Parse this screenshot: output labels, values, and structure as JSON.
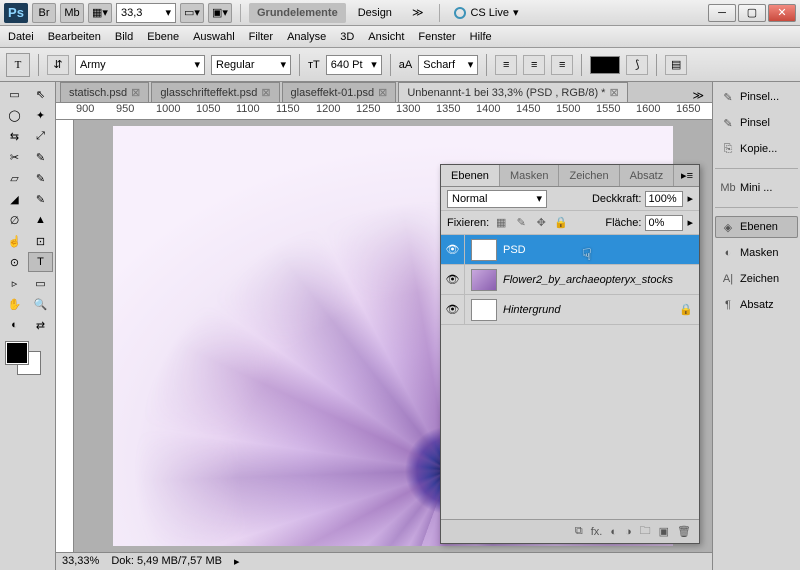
{
  "titlebar": {
    "app": "Ps",
    "bridge": "Br",
    "mb": "Mb",
    "zoom": "33,3",
    "workspace_active": "Grundelemente",
    "workspace_other": "Design",
    "cslive": "CS Live"
  },
  "menu": [
    "Datei",
    "Bearbeiten",
    "Bild",
    "Ebene",
    "Auswahl",
    "Filter",
    "Analyse",
    "3D",
    "Ansicht",
    "Fenster",
    "Hilfe"
  ],
  "options": {
    "tool": "T",
    "font": "Army",
    "style": "Regular",
    "size": "640 Pt",
    "aa_label": "aA",
    "aa": "Scharf"
  },
  "tabs": [
    {
      "label": "statisch.psd",
      "active": false
    },
    {
      "label": "glasschrifteffekt.psd",
      "active": false
    },
    {
      "label": "glaseffekt-01.psd",
      "active": false
    },
    {
      "label": "Unbenannt-1 bei 33,3% (PSD      , RGB/8) *",
      "active": true
    }
  ],
  "ruler_marks": [
    "900",
    "950",
    "1000",
    "1050",
    "1100",
    "1150",
    "1200",
    "1250",
    "1300",
    "1350",
    "1400",
    "1450",
    "1500",
    "1550",
    "1600",
    "1650"
  ],
  "status": {
    "zoom": "33,33%",
    "doc": "Dok: 5,49 MB/7,57 MB"
  },
  "layers_panel": {
    "tabs": [
      "Ebenen",
      "Masken",
      "Zeichen",
      "Absatz"
    ],
    "blend": "Normal",
    "opacity_label": "Deckkraft:",
    "opacity_val": "100%",
    "fix_label": "Fixieren:",
    "fill_label": "Fläche:",
    "fill_val": "0%",
    "layers": [
      {
        "name": "PSD",
        "type": "T",
        "sel": true
      },
      {
        "name": "Flower2_by_archaeopteryx_stocks",
        "type": "img",
        "italic": true
      },
      {
        "name": "Hintergrund",
        "type": "bg",
        "italic": true,
        "locked": true
      }
    ]
  },
  "right_panels": [
    {
      "label": "Pinsel...",
      "icon": "✎"
    },
    {
      "label": "Pinsel",
      "icon": "✎"
    },
    {
      "label": "Kopie...",
      "icon": "⎘"
    },
    {
      "label": "Mini ...",
      "icon": "Mb",
      "divider_before": true
    },
    {
      "label": "Ebenen",
      "icon": "◈",
      "active": true,
      "divider_before": true
    },
    {
      "label": "Masken",
      "icon": "◐"
    },
    {
      "label": "Zeichen",
      "icon": "A|"
    },
    {
      "label": "Absatz",
      "icon": "¶"
    }
  ]
}
